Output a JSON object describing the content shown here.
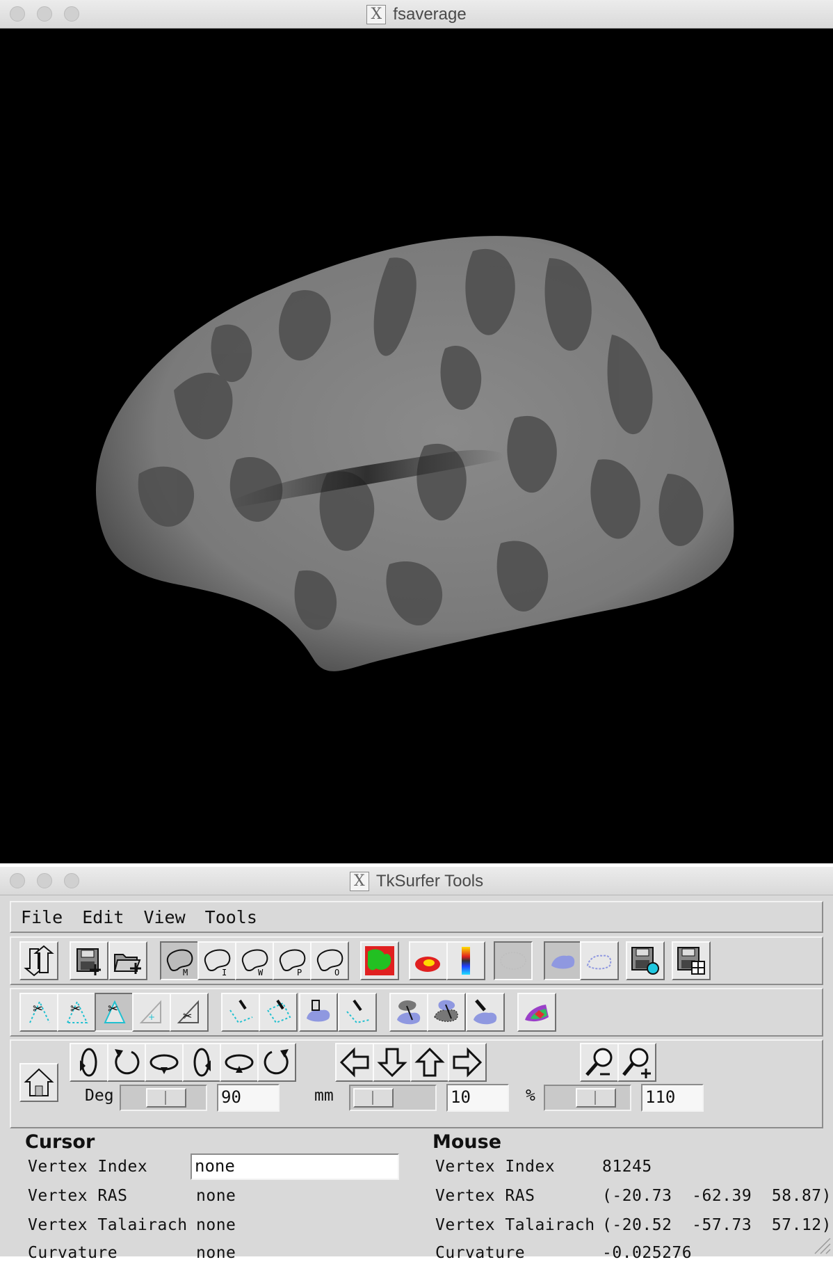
{
  "main_window": {
    "title": "fsaverage",
    "title_icon": "X"
  },
  "tools_window": {
    "title": "TkSurfer Tools",
    "title_icon": "X",
    "menu": [
      "File",
      "Edit",
      "View",
      "Tools"
    ],
    "toolbar1": [
      "redraw-icon",
      "save-icon",
      "load-icon",
      "brain-medial-icon",
      "brain-inflated-icon",
      "brain-white-icon",
      "brain-pial-icon",
      "brain-orig-icon",
      "label-overlay-icon",
      "blob-overlay-icon",
      "colorbar-icon",
      "roi-empty-icon",
      "roi-filled-icon",
      "roi-outline-icon",
      "save-rgb-icon",
      "save-tiff-icon"
    ],
    "toolbar2": [
      "cut-line-icon",
      "cut-closed-icon",
      "cut-plane-icon",
      "plane-icon",
      "plane-cut-icon",
      "path-line-icon",
      "path-closed-icon",
      "fill-icon",
      "path-erase-icon",
      "custom-fill-icon",
      "custom-fill-up-icon",
      "erase-fill-icon",
      "color-patch-icon"
    ],
    "rotations": [
      "rotate-y-left-icon",
      "rotate-z-ccw-icon",
      "rotate-x-down-icon",
      "rotate-y-right-icon",
      "rotate-x-up-icon",
      "rotate-z-cw-icon"
    ],
    "arrows": [
      "arrow-left-icon",
      "arrow-down-icon",
      "arrow-up-icon",
      "arrow-right-icon"
    ],
    "zoom": [
      "zoom-out-icon",
      "zoom-in-icon"
    ],
    "deg_label": "Deg",
    "deg_value": "90",
    "mm_label": "mm",
    "mm_value": "10",
    "pct_label": "%",
    "pct_value": "110",
    "cursor": {
      "heading": "Cursor",
      "rows": [
        {
          "label": "Vertex Index",
          "value": "none"
        },
        {
          "label": "Vertex RAS",
          "value": "none"
        },
        {
          "label": "Vertex Talairach",
          "value": "none"
        },
        {
          "label": "Curvature",
          "value": "none"
        }
      ]
    },
    "mouse": {
      "heading": "Mouse",
      "rows": [
        {
          "label": "Vertex Index",
          "value": "81245"
        },
        {
          "label": "Vertex RAS",
          "value": "(-20.73  -62.39  58.87)"
        },
        {
          "label": "Vertex Talairach",
          "value": "(-20.52  -57.73  57.12)"
        },
        {
          "label": "Curvature",
          "value": "-0.025276"
        }
      ]
    }
  }
}
